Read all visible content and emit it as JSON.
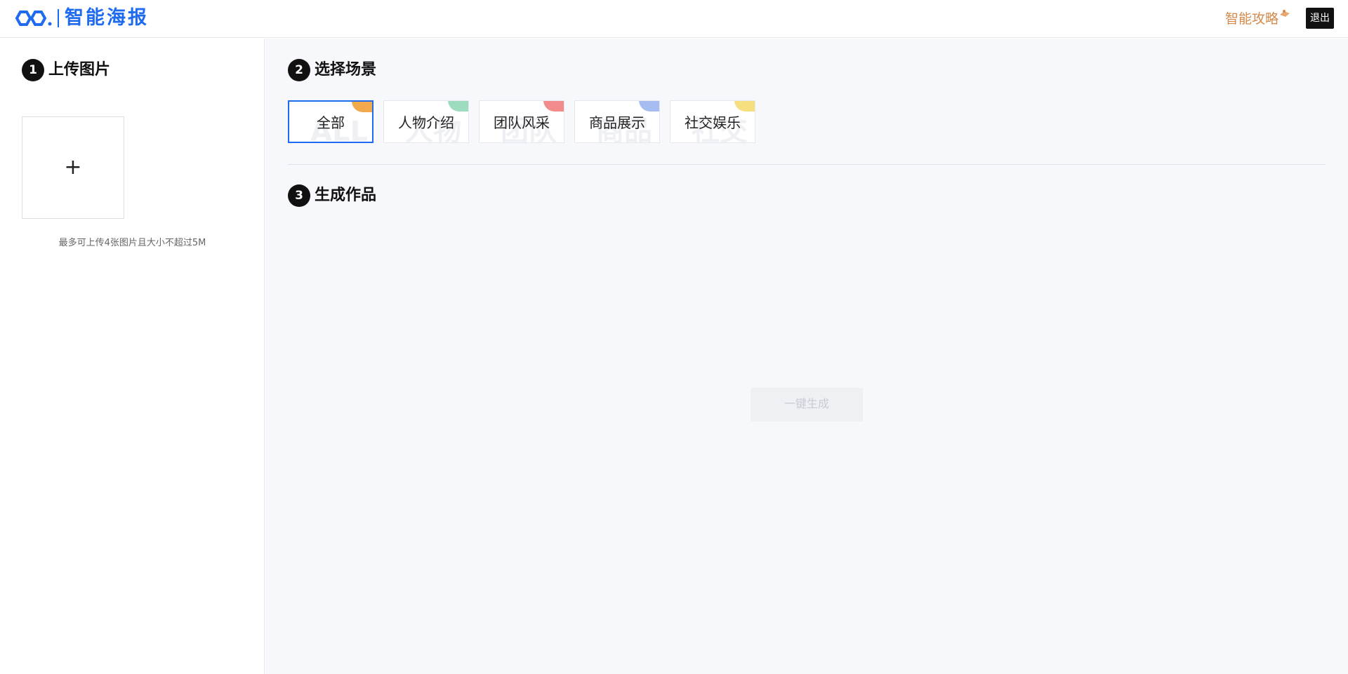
{
  "header": {
    "logo_text": "智能海报",
    "guide_label": "智能攻略",
    "logout_label": "退出"
  },
  "upload": {
    "step_number": "1",
    "title": "上传图片",
    "plus": "+",
    "hint": "最多可上传4张图片且大小不超过5M"
  },
  "scene": {
    "step_number": "2",
    "title": "选择场景",
    "items": [
      {
        "label": "全部",
        "bg": "ALL",
        "corner_color": "#f2a94c",
        "active": true
      },
      {
        "label": "人物介绍",
        "bg": "人物",
        "corner_color": "#9ddcbe",
        "active": false
      },
      {
        "label": "团队风采",
        "bg": "团队",
        "corner_color": "#f28b8b",
        "active": false
      },
      {
        "label": "商品展示",
        "bg": "商品",
        "corner_color": "#a7bdf2",
        "active": false
      },
      {
        "label": "社交娱乐",
        "bg": "社交",
        "corner_color": "#f6df7e",
        "active": false
      }
    ]
  },
  "generate": {
    "step_number": "3",
    "title": "生成作品",
    "button_label": "一键生成"
  },
  "colors": {
    "brand": "#1f6bf0",
    "guide": "#d4894a",
    "background": "#f7f8fb"
  }
}
